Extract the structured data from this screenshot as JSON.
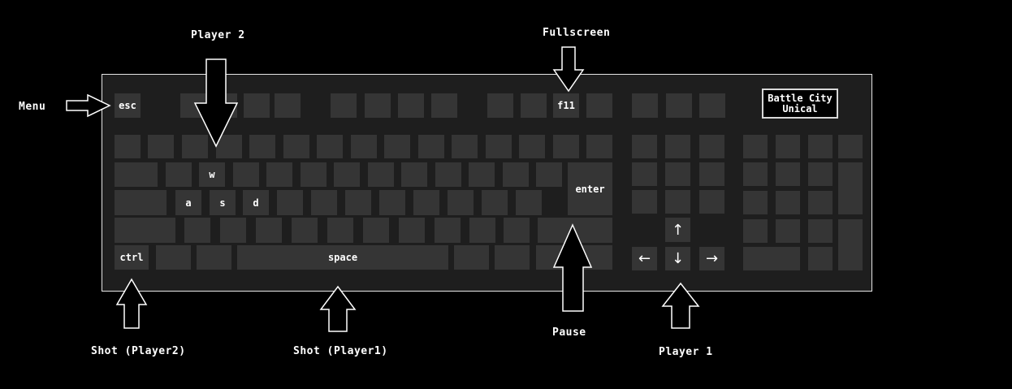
{
  "labels": {
    "player2": "Player 2",
    "fullscreen": "Fullscreen",
    "menu": "Menu",
    "shot_player2": "Shot (Player2)",
    "shot_player1": "Shot (Player1)",
    "pause": "Pause",
    "player1": "Player 1"
  },
  "brand": {
    "line1": "Battle City",
    "line2": "Unical"
  },
  "keys": {
    "esc": "esc",
    "f11": "f11",
    "w": "w",
    "a": "a",
    "s": "s",
    "d": "d",
    "enter": "enter",
    "ctrl": "ctrl",
    "space": "space",
    "up": "↑",
    "left": "←",
    "down": "↓",
    "right": "→"
  },
  "colors": {
    "background": "#000000",
    "keyboard": "#1e1e1e",
    "key": "#353535",
    "outline": "#ffffff"
  }
}
